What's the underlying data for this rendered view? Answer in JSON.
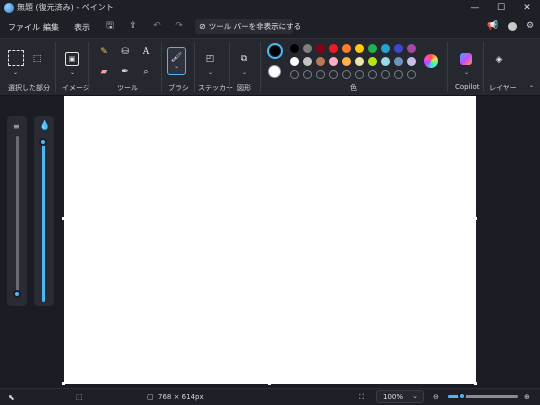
{
  "window": {
    "title": "無題 (復元済み) - ペイント",
    "minimize_icon": "minimize-icon",
    "maximize_icon": "maximize-icon",
    "close_icon": "close-icon"
  },
  "menu": {
    "items": [
      "ファイル",
      "編集",
      "表示"
    ],
    "hide_toolbar_label": "ツール バーを非表示にする"
  },
  "ribbon": {
    "groups": {
      "selection": "選択した部分",
      "image": "イメージ",
      "tools": "ツール",
      "brush": "ブラシ",
      "sticker": "ステッカー",
      "shapes": "図形",
      "color": "色",
      "copilot": "Copilot",
      "layers": "レイヤー"
    },
    "primary_color": "#000000",
    "secondary_color": "#ffffff",
    "palette_row1": [
      "#000000",
      "#7f7f7f",
      "#880015",
      "#ed1c24",
      "#ff7f27",
      "#ffc90e",
      "#22b14c",
      "#22a3d6",
      "#3f48cc",
      "#a349a4"
    ],
    "palette_row2": [
      "#ffffff",
      "#c3c3c3",
      "#b97a57",
      "#ffaec9",
      "#ffb347",
      "#efe4b0",
      "#b5e61d",
      "#99d9ea",
      "#7092be",
      "#c8bfe7"
    ]
  },
  "status": {
    "canvas_size": "768 × 614px",
    "zoom": "100%",
    "zoom_fraction": 0.2
  }
}
